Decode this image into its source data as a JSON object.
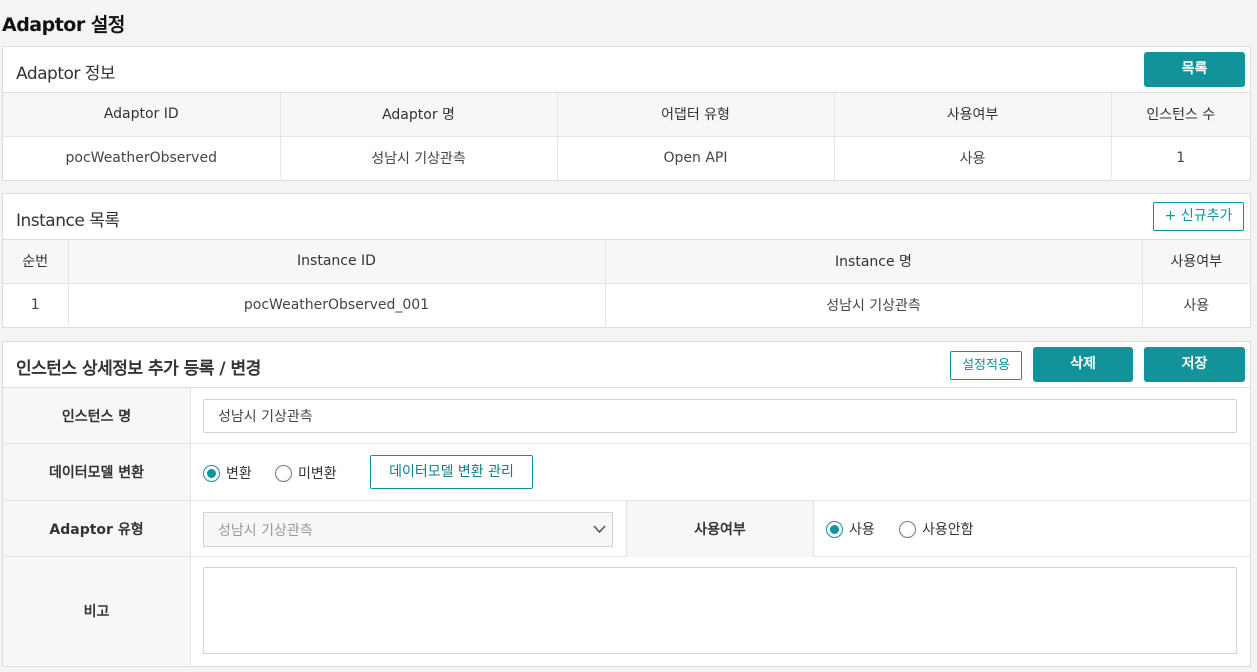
{
  "page_title": "Adaptor 설정",
  "adaptor_info": {
    "title": "Adaptor 정보",
    "list_button": "목록",
    "columns": [
      "Adaptor ID",
      "Adaptor 명",
      "어댑터 유형",
      "사용여부",
      "인스턴스 수"
    ],
    "row": [
      "pocWeatherObserved",
      "성남시 기상관측",
      "Open API",
      "사용",
      "1"
    ]
  },
  "instance_list": {
    "title": "Instance 목록",
    "add_button": "+ 신규추가",
    "columns": [
      "순번",
      "Instance ID",
      "Instance 명",
      "사용여부"
    ],
    "row": [
      "1",
      "pocWeatherObserved_001",
      "성남시 기상관측",
      "사용"
    ]
  },
  "detail": {
    "title": "인스턴스 상세정보 추가 등록 / 변경",
    "apply_button": "설정적용",
    "delete_button": "삭제",
    "save_button": "저장",
    "instance_name_label": "인스턴스 명",
    "instance_name_value": "성남시 기상관측",
    "model_convert_label": "데이터모델 변환",
    "radio_convert": "변환",
    "radio_no_convert": "미변환",
    "model_manage_button": "데이터모델 변환 관리",
    "adaptor_type_label": "Adaptor 유형",
    "adaptor_type_value": "성남시 기상관측",
    "use_label": "사용여부",
    "radio_use": "사용",
    "radio_not_use": "사용안함",
    "note_label": "비고",
    "note_value": ""
  },
  "colors": {
    "accent": "#12939a"
  }
}
